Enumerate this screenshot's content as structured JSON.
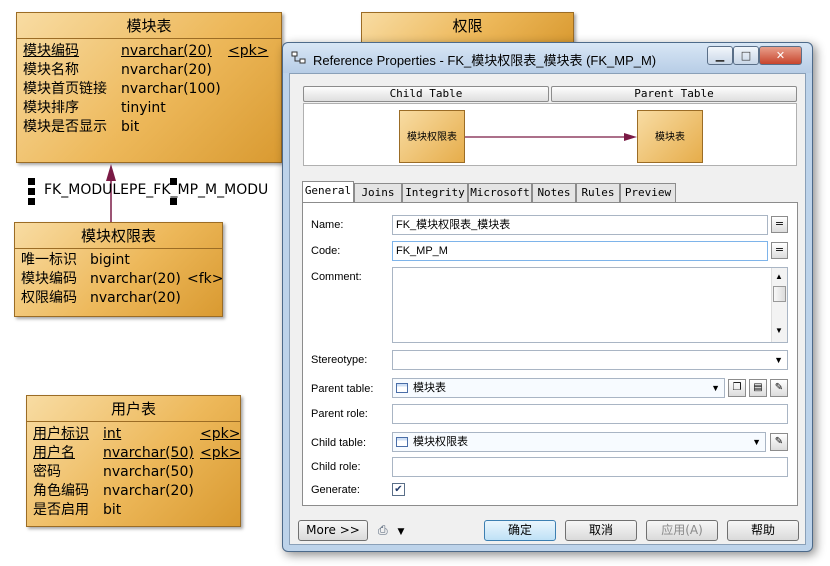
{
  "diagram": {
    "module_table": {
      "title": "模块表",
      "rows": [
        {
          "name": "模块编码",
          "type": "nvarchar(20)",
          "key": "<pk>"
        },
        {
          "name": "模块名称",
          "type": "nvarchar(20)",
          "key": ""
        },
        {
          "name": "模块首页链接",
          "type": "nvarchar(100)",
          "key": ""
        },
        {
          "name": "模块排序",
          "type": "tinyint",
          "key": ""
        },
        {
          "name": "模块是否显示",
          "type": "bit",
          "key": ""
        }
      ]
    },
    "permission_table": {
      "title": "权限"
    },
    "module_permission_table": {
      "title": "模块权限表",
      "rows": [
        {
          "name": "唯一标识",
          "type": "bigint",
          "key": ""
        },
        {
          "name": "模块编码",
          "type": "nvarchar(20)",
          "key": "<fk>"
        },
        {
          "name": "权限编码",
          "type": "nvarchar(20)",
          "key": ""
        }
      ]
    },
    "user_table": {
      "title": "用户表",
      "rows": [
        {
          "name": "用户标识",
          "type": "int",
          "key": "<pk>"
        },
        {
          "name": "用户名",
          "type": "nvarchar(50)",
          "key": "<pk>"
        },
        {
          "name": "密码",
          "type": "nvarchar(50)",
          "key": ""
        },
        {
          "name": "角色编码",
          "type": "nvarchar(20)",
          "key": ""
        },
        {
          "name": "是否启用",
          "type": "bit",
          "key": ""
        }
      ]
    },
    "reference_label": "FK_MODULEPE_FK_MP_M_MODU"
  },
  "dialog": {
    "title": "Reference Properties - FK_模块权限表_模块表 (FK_MP_M)",
    "header": {
      "child_table": "Child Table",
      "parent_table": "Parent Table"
    },
    "preview": {
      "child": "模块权限表",
      "parent": "模块表"
    },
    "tabs": [
      "General",
      "Joins",
      "Integrity",
      "Microsoft",
      "Notes",
      "Rules",
      "Preview"
    ],
    "form": {
      "name_label": "Name:",
      "name_value": "FK_模块权限表_模块表",
      "code_label": "Code:",
      "code_value": "FK_MP_M",
      "comment_label": "Comment:",
      "comment_value": "",
      "stereotype_label": "Stereotype:",
      "stereotype_value": "",
      "parent_table_label": "Parent table:",
      "parent_table_value": "模块表",
      "parent_role_label": "Parent role:",
      "parent_role_value": "",
      "child_table_label": "Child table:",
      "child_table_value": "模块权限表",
      "child_role_label": "Child role:",
      "child_role_value": "",
      "generate_label": "Generate:",
      "generate_checked": true,
      "eq_symbol": "="
    },
    "buttons": {
      "more": "More >>",
      "ok": "确定",
      "cancel": "取消",
      "apply": "应用(A)",
      "help": "帮助"
    }
  }
}
